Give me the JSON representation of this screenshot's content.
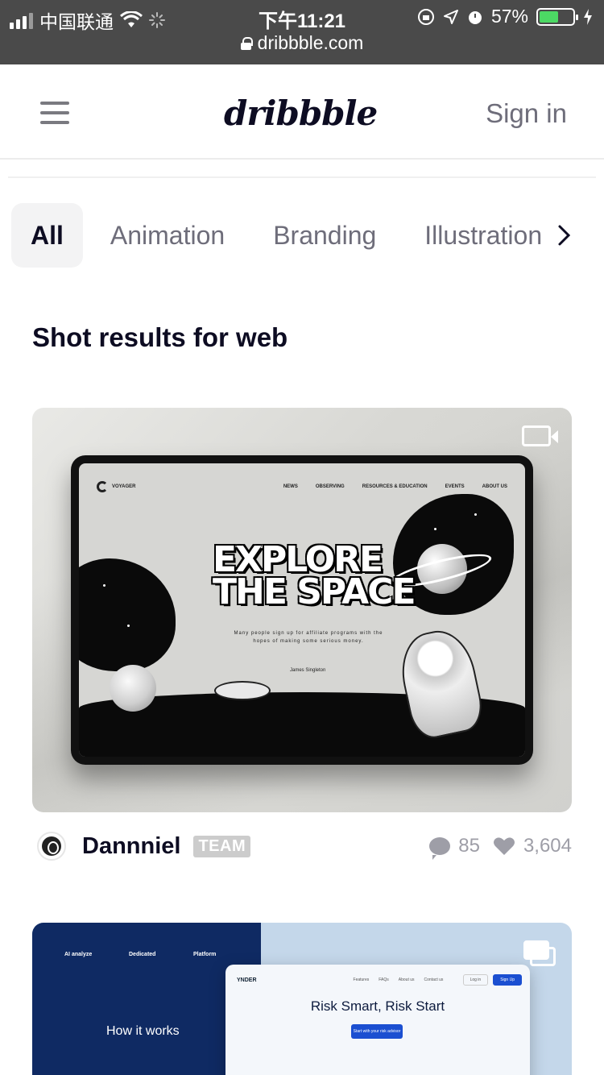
{
  "status_bar": {
    "carrier": "中国联通",
    "time": "下午11:21",
    "battery": "57%",
    "battery_level": 0.57,
    "url": "dribbble.com"
  },
  "header": {
    "logo": "dribbble",
    "signin_label": "Sign in"
  },
  "tabs": [
    {
      "label": "All",
      "active": true
    },
    {
      "label": "Animation",
      "active": false
    },
    {
      "label": "Branding",
      "active": false
    },
    {
      "label": "Illustration",
      "active": false
    }
  ],
  "section_title": "Shot results for web",
  "shots": [
    {
      "media": "video",
      "preview": {
        "brand": "VOYAGER",
        "nav": [
          "NEWS",
          "OBSERVING",
          "RESOURCES & EDUCATION",
          "EVENTS",
          "ABOUT US"
        ],
        "headline_1": "EXPLORE",
        "headline_2": "THE SPACE",
        "tagline": "Many people sign up for affiliate programs with the hopes of making some serious money.",
        "byline": "James Singleton"
      },
      "author": "Dannniel",
      "badge": "TEAM",
      "comments": "85",
      "likes": "3,604"
    },
    {
      "media": "multi",
      "preview": {
        "columns": [
          {
            "title": "AI analyze"
          },
          {
            "title": "Dedicated"
          },
          {
            "title": "Platform"
          }
        ],
        "left_heading": "How it works",
        "brand": "YNDER",
        "nav": [
          "Features",
          "FAQs",
          "About us",
          "Contact us"
        ],
        "login": "Log in",
        "signup": "Sign Up",
        "headline": "Risk Smart, Risk Start",
        "cta": "Start with your risk advisor"
      }
    }
  ],
  "colors": {
    "status_bg": "#4a4a4a",
    "text_primary": "#0d0c22",
    "text_muted": "#6e6d7a",
    "stats": "#9e9ea7",
    "battery_fill": "#4cd964",
    "team_badge": "#cccccc"
  },
  "icons": [
    "signal-icon",
    "wifi-icon",
    "loading-icon",
    "lock-icon",
    "rotation-lock-icon",
    "location-icon",
    "alarm-icon",
    "battery-icon",
    "charging-icon",
    "hamburger-menu-icon",
    "chevron-right-icon",
    "video-icon",
    "comment-icon",
    "heart-icon",
    "multi-shot-icon"
  ]
}
